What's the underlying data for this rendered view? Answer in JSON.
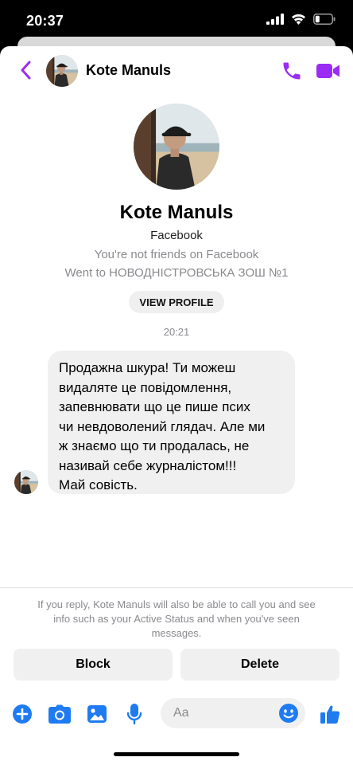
{
  "status_bar": {
    "time": "20:37"
  },
  "header": {
    "contact_name": "Kote Manuls"
  },
  "profile": {
    "name": "Kote Manuls",
    "source": "Facebook",
    "friend_status": "You're not friends on Facebook",
    "education": "Went to НОВОДНІСТРОВСЬКА ЗОШ №1",
    "view_profile_label": "VIEW PROFILE"
  },
  "conversation": {
    "timestamp": "20:21",
    "message_lines": [
      "Продажна шкура! Ти можеш",
      "видаляте це повідомлення,",
      "запевнювати що це пише псих",
      "чи невдоволений глядач. Але ми",
      "ж знаємо що ти продалась, не",
      "називай себе журналістом!!!",
      "Май совість."
    ]
  },
  "request_panel": {
    "notice_lines": [
      "If you reply, Kote Manuls will also be able to call you and see",
      "info such as your Active Status and when you've seen",
      "messages."
    ],
    "block_label": "Block",
    "delete_label": "Delete"
  },
  "composer": {
    "placeholder": "Aa"
  },
  "colors": {
    "accent": "#9b2cf6",
    "toolbar_blue": "#1f7bf2",
    "bubble_bg": "#f0f0f0",
    "secondary_text": "#8a8a8f"
  },
  "icons": {
    "back": "chevron-left-icon",
    "call": "phone-icon",
    "video": "video-camera-icon",
    "add": "plus-circle-icon",
    "camera": "camera-icon",
    "gallery": "image-icon",
    "voice": "microphone-icon",
    "emoji": "smiley-icon",
    "like": "thumbs-up-icon"
  }
}
